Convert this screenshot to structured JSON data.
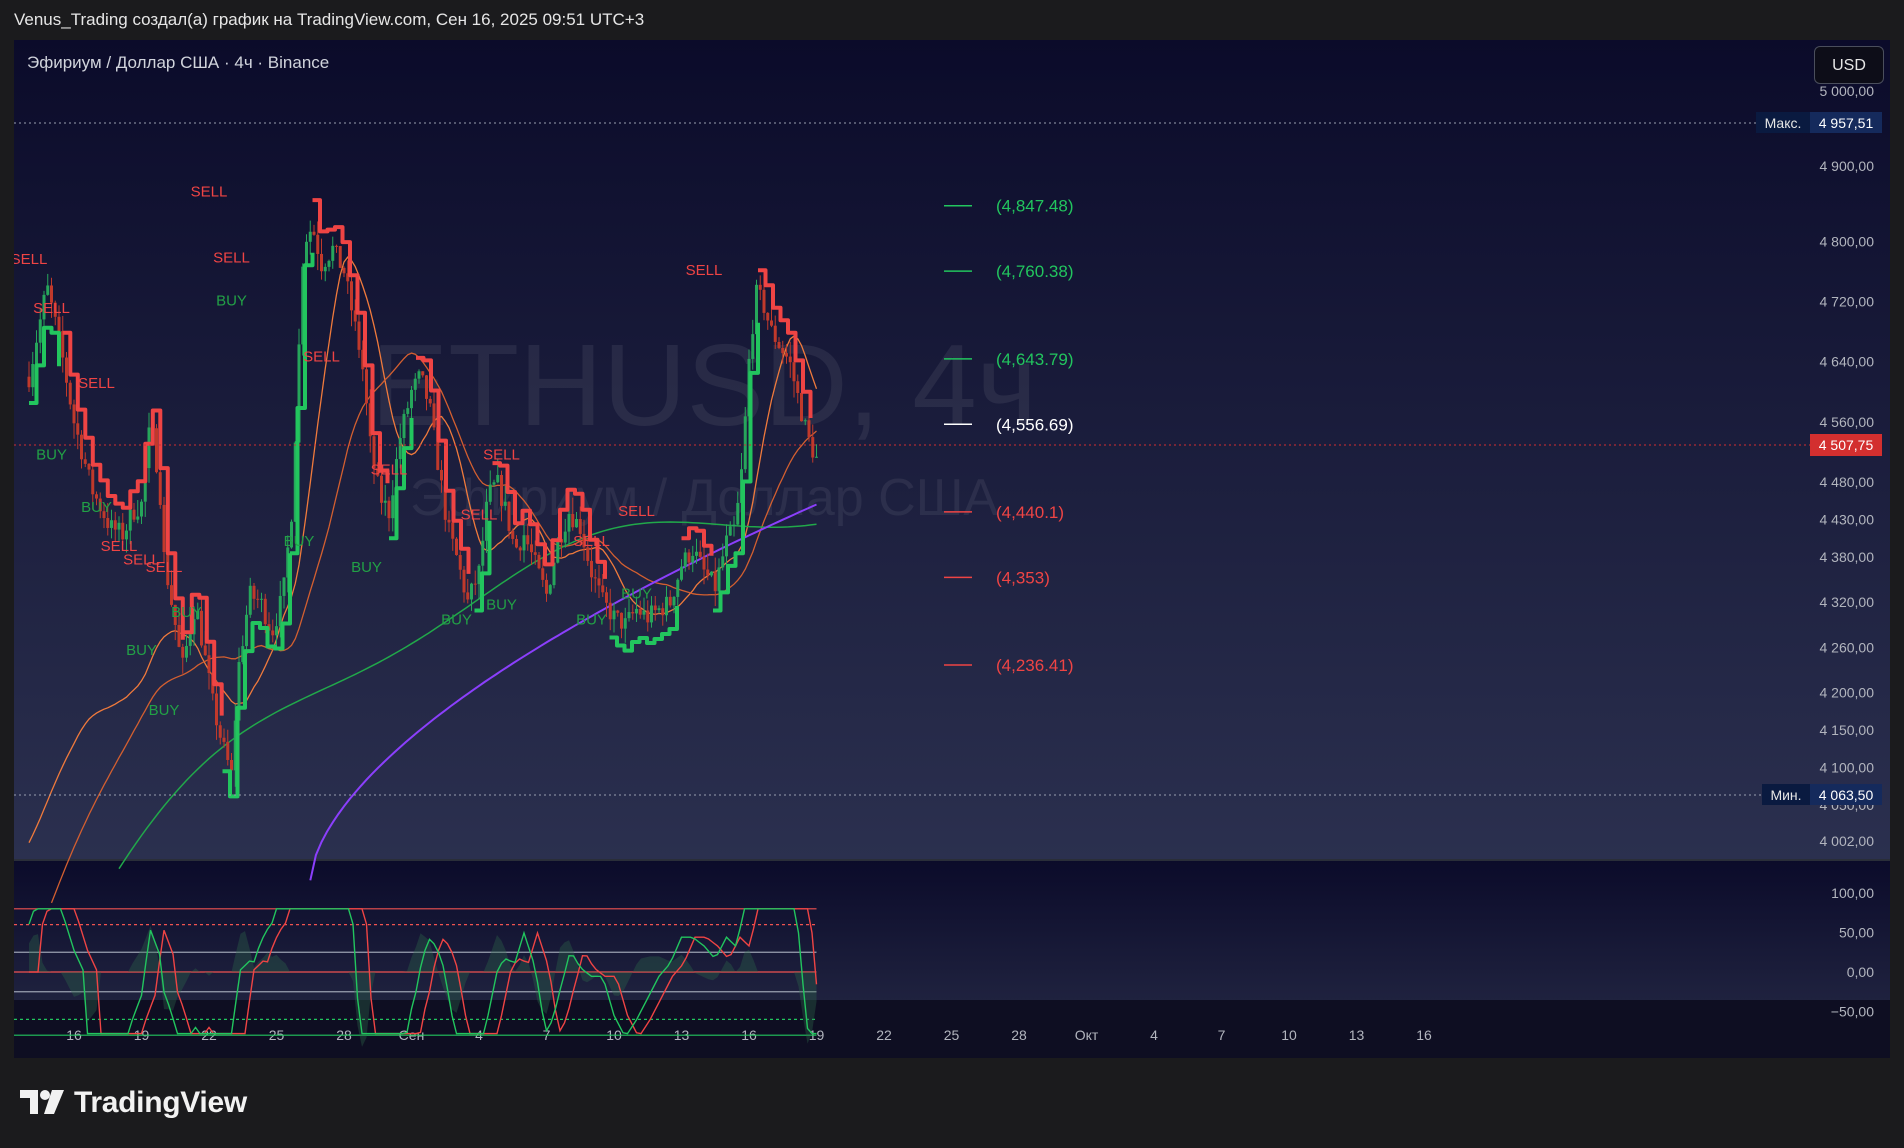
{
  "header": {
    "caption": "Venus_Trading создал(а) график на TradingView.com, Сен 16, 2025 09:51 UTC+3"
  },
  "chart": {
    "symbol_title": "Эфириум / Доллар США · 4ч · Binance",
    "currency_button": "USD",
    "watermark_line1": "ETHUSD, 4ч",
    "watermark_line2": "Эфириум / Доллар США",
    "max_label": "Макс.",
    "max_value": "4 957,51",
    "min_label": "Мин.",
    "min_value": "4 063,50",
    "last_price": "4 507,75",
    "colors": {
      "background_top": "#0b0b2a",
      "background_bottom": "#2a2f4d",
      "buy_green": "#22c55e",
      "sell_red": "#ef4444",
      "purple_line": "#8b3ffc",
      "orange_line": "#f07a3c",
      "last_price_badge": "#d32f2f"
    }
  },
  "chart_data": [
    {
      "type": "line",
      "title": "Эфириум / Доллар США · 4ч · Binance",
      "x_tick_labels": [
        "16",
        "19",
        "22",
        "25",
        "28",
        "Сен",
        "4",
        "7",
        "10",
        "13",
        "16",
        "19",
        "22",
        "25",
        "28",
        "Окт",
        "4",
        "7",
        "10",
        "13",
        "16"
      ],
      "y_tick_labels": [
        "5 000,00",
        "4 900,00",
        "4 800,00",
        "4 720,00",
        "4 640,00",
        "4 560,00",
        "4 480,00",
        "4 430,00",
        "4 380,00",
        "4 320,00",
        "4 260,00",
        "4 200,00",
        "4 150,00",
        "4 100,00",
        "4 050,00",
        "4 002,00"
      ],
      "ylim": [
        3970,
        5020
      ],
      "grid": false,
      "target_levels": [
        {
          "label": "(4,847.48)",
          "value": 4847.48,
          "color": "#22c55e"
        },
        {
          "label": "(4,760.38)",
          "value": 4760.38,
          "color": "#22c55e"
        },
        {
          "label": "(4,643.79)",
          "value": 4643.79,
          "color": "#22c55e"
        },
        {
          "label": "(4,556.69)",
          "value": 4556.69,
          "color": "#ffffff"
        },
        {
          "label": "(4,440.1)",
          "value": 4440.1,
          "color": "#ef4444"
        },
        {
          "label": "(4,353)",
          "value": 4353,
          "color": "#ef4444"
        },
        {
          "label": "(4,236.41)",
          "value": 4236.41,
          "color": "#ef4444"
        }
      ],
      "signals": [
        {
          "type": "SELL",
          "x": "Aug 14",
          "value": 4770
        },
        {
          "type": "SELL",
          "x": "Aug 15",
          "value": 4705
        },
        {
          "type": "BUY",
          "x": "Aug 15",
          "value": 4510
        },
        {
          "type": "SELL",
          "x": "Aug 17",
          "value": 4605
        },
        {
          "type": "BUY",
          "x": "Aug 17",
          "value": 4440
        },
        {
          "type": "SELL",
          "x": "Aug 18",
          "value": 4388
        },
        {
          "type": "SELL",
          "x": "Aug 19",
          "value": 4370
        },
        {
          "type": "BUY",
          "x": "Aug 19",
          "value": 4250
        },
        {
          "type": "BUY",
          "x": "Aug 20",
          "value": 4170
        },
        {
          "type": "SELL",
          "x": "Aug 20",
          "value": 4360
        },
        {
          "type": "BUY",
          "x": "Aug 21",
          "value": 4300
        },
        {
          "type": "SELL",
          "x": "Aug 22",
          "value": 4860
        },
        {
          "type": "BUY",
          "x": "Aug 23",
          "value": 4715
        },
        {
          "type": "SELL",
          "x": "Aug 23",
          "value": 4772
        },
        {
          "type": "BUY",
          "x": "Aug 26",
          "value": 4395
        },
        {
          "type": "SELL",
          "x": "Aug 27",
          "value": 4640
        },
        {
          "type": "BUY",
          "x": "Aug 29",
          "value": 4360
        },
        {
          "type": "SELL",
          "x": "Aug 30",
          "value": 4490
        },
        {
          "type": "BUY",
          "x": "Sep 2",
          "value": 4290
        },
        {
          "type": "SELL",
          "x": "Sep 3",
          "value": 4430
        },
        {
          "type": "SELL",
          "x": "Sep 4",
          "value": 4510
        },
        {
          "type": "BUY",
          "x": "Sep 4",
          "value": 4310
        },
        {
          "type": "SELL",
          "x": "Sep 8",
          "value": 4395
        },
        {
          "type": "BUY",
          "x": "Sep 8",
          "value": 4290
        },
        {
          "type": "SELL",
          "x": "Sep 10",
          "value": 4435
        },
        {
          "type": "BUY",
          "x": "Sep 10",
          "value": 4325
        },
        {
          "type": "SELL",
          "x": "Sep 13",
          "value": 4755
        }
      ]
    },
    {
      "type": "line",
      "title": "",
      "y_tick_labels": [
        "100,00",
        "50,00",
        "0,00",
        "−50,00"
      ],
      "ylim": [
        -90,
        105
      ],
      "grid": false
    }
  ]
}
